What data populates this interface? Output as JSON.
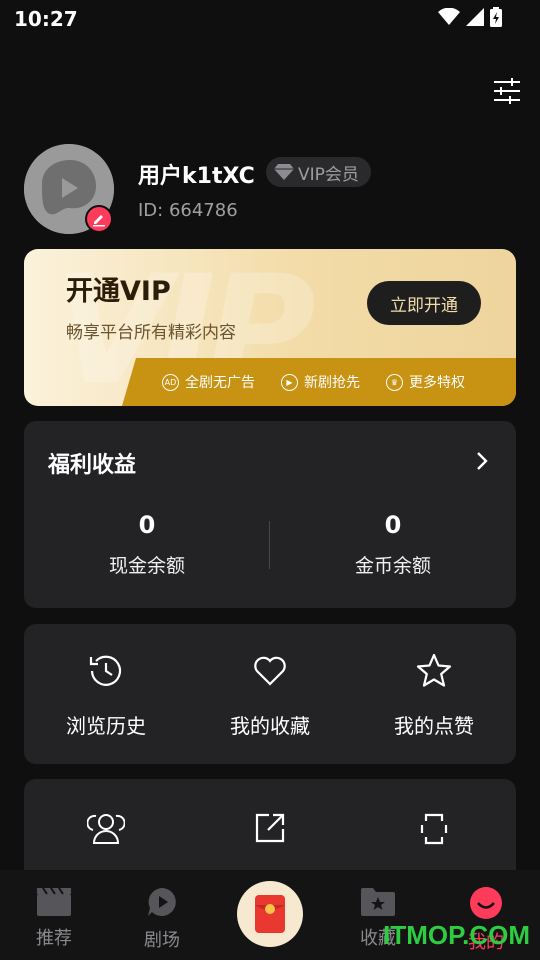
{
  "status": {
    "time": "10:27"
  },
  "profile": {
    "username": "用户k1tXC",
    "vip_badge": "VIP会员",
    "id_text": "ID: 664786"
  },
  "vip_card": {
    "title": "开通VIP",
    "subtitle": "畅享平台所有精彩内容",
    "button": "立即开通",
    "perks": [
      {
        "icon": "ad-icon",
        "label": "全剧无广告"
      },
      {
        "icon": "new-play-icon",
        "label": "新剧抢先"
      },
      {
        "icon": "crown-icon",
        "label": "更多特权"
      }
    ]
  },
  "welfare": {
    "title": "福利收益",
    "cash_value": "0",
    "cash_label": "现金余额",
    "coin_value": "0",
    "coin_label": "金币余额"
  },
  "quick": [
    {
      "icon": "history-icon",
      "label": "浏览历史"
    },
    {
      "icon": "heart-icon",
      "label": "我的收藏"
    },
    {
      "icon": "star-icon",
      "label": "我的点赞"
    }
  ],
  "more": [
    {
      "icon": "users-icon"
    },
    {
      "icon": "share-icon"
    },
    {
      "icon": "phone-icon"
    }
  ],
  "nav": {
    "recommend": "推荐",
    "theater": "剧场",
    "collect": "收藏",
    "mine": "我的"
  },
  "watermark": "ITMOP.COM",
  "colors": {
    "accent": "#ff3b5c",
    "vip_gold": "#c89212",
    "card_bg": "#232325"
  }
}
